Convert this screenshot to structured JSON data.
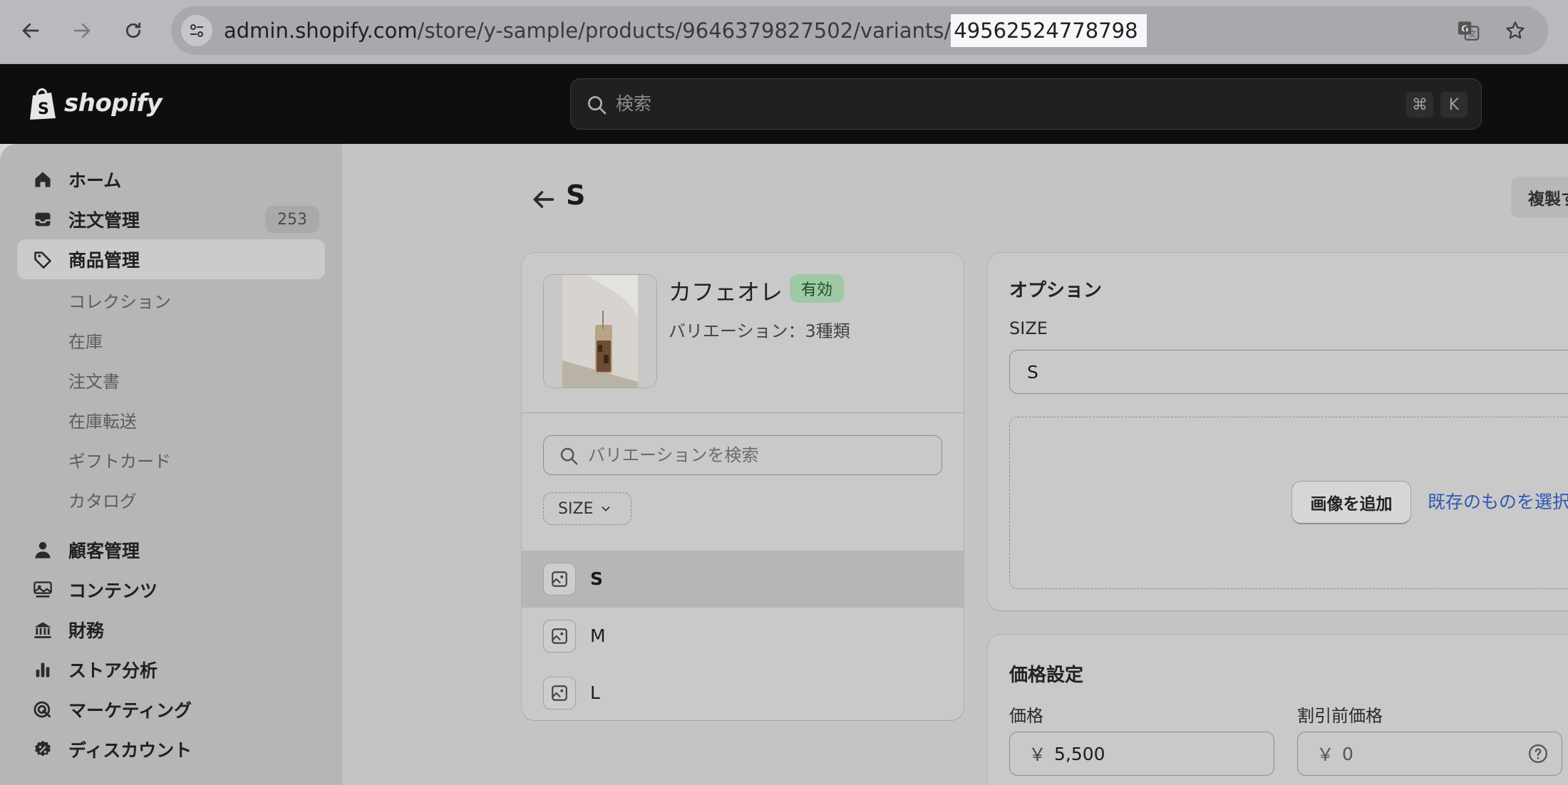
{
  "browser": {
    "url_host": "admin.shopify.com",
    "url_path": "/store/y-sample/products/9646379827502/variants/",
    "url_highlight": "49562524778798"
  },
  "topbar": {
    "logo_text": "shopify",
    "search_placeholder": "検索",
    "shortcut_cmd": "⌘",
    "shortcut_key": "K"
  },
  "sidebar": {
    "items": [
      {
        "label": "ホーム",
        "icon": "home-icon"
      },
      {
        "label": "注文管理",
        "icon": "inbox-icon",
        "count": "253"
      },
      {
        "label": "商品管理",
        "icon": "tag-icon",
        "active": true
      }
    ],
    "sub_items": [
      "コレクション",
      "在庫",
      "注文書",
      "在庫転送",
      "ギフトカード",
      "カタログ"
    ],
    "items2": [
      {
        "label": "顧客管理",
        "icon": "person-icon"
      },
      {
        "label": "コンテンツ",
        "icon": "content-icon"
      },
      {
        "label": "財務",
        "icon": "bank-icon"
      },
      {
        "label": "ストア分析",
        "icon": "bar-chart-icon"
      },
      {
        "label": "マーケティング",
        "icon": "target-icon"
      },
      {
        "label": "ディスカウント",
        "icon": "discount-icon"
      }
    ]
  },
  "page": {
    "title": "S",
    "duplicate_label": "複製す"
  },
  "product": {
    "name": "カフェオレ",
    "status": "有効",
    "variation_count": "バリエーション：3種類",
    "variant_search_placeholder": "バリエーションを検索",
    "filter_chip": "SIZE",
    "variants": [
      "S",
      "M",
      "L"
    ]
  },
  "options": {
    "title": "オプション",
    "size_label": "SIZE",
    "size_value": "S",
    "add_image": "画像を追加",
    "select_existing": "既存のものを選択"
  },
  "pricing": {
    "title": "価格設定",
    "price_label": "価格",
    "price_currency": "￥",
    "price_value": "5,500",
    "compare_label": "割引前価格",
    "compare_currency": "￥",
    "compare_value": "0"
  },
  "colors": {
    "accent_link": "#2e57b4",
    "status_green": "#9fc8a4"
  }
}
